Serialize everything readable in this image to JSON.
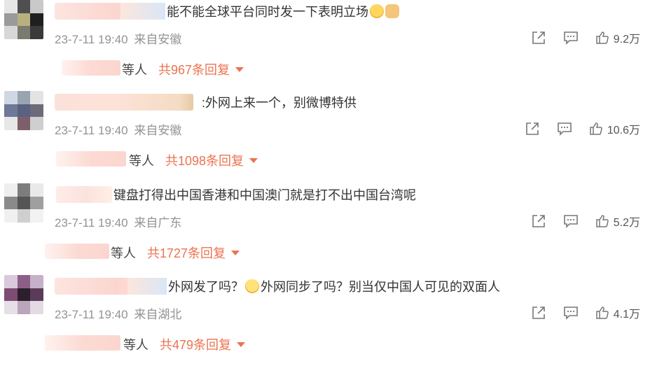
{
  "comments": [
    {
      "text": "能不能全球平台同时发一下表明立场",
      "emojis": [
        "laughing-tears-emoji",
        "rock-on-hand-emoji"
      ],
      "time": "23-7-11 19:40",
      "location": "来自安徽",
      "likes": "9.2万",
      "reply_who": "等人",
      "reply_count": "共967条回复"
    },
    {
      "text": ":外网上来一个，别微博特供",
      "emojis": [],
      "time": "23-7-11 19:40",
      "location": "来自安徽",
      "likes": "10.6万",
      "reply_who": "等人",
      "reply_count": "共1098条回复"
    },
    {
      "text": "键盘打得出中国香港和中国澳门就是打不出中国台湾呢",
      "emojis": [],
      "time": "23-7-11 19:40",
      "location": "来自广东",
      "likes": "5.2万",
      "reply_who": "等人",
      "reply_count": "共1727条回复"
    },
    {
      "text_part1": "外网发了吗？",
      "text_part2": "外网同步了吗？别当仅中国人可见的双面人",
      "emojis": [
        "thinking-face-emoji"
      ],
      "time": "23-7-11 19:40",
      "location": "来自湖北",
      "likes": "4.1万",
      "reply_who": "等人",
      "reply_count": "共479条回复"
    }
  ],
  "icons": {
    "share": "share-icon",
    "comment": "comment-icon",
    "like": "thumbs-up-icon",
    "expand": "caret-down-icon"
  },
  "colors": {
    "accent": "#eb7350",
    "meta_text": "#939393",
    "main_text": "#333333"
  }
}
